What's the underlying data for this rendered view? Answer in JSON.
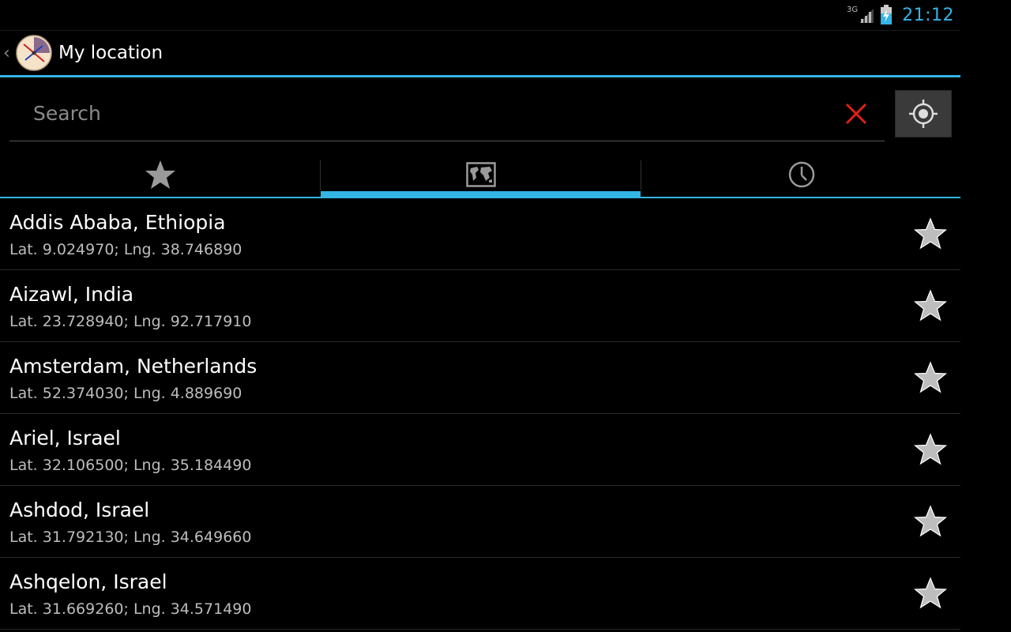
{
  "status": {
    "network": "3G",
    "time": "21:12"
  },
  "action_bar": {
    "title": "My location"
  },
  "search": {
    "placeholder": "Search",
    "value": ""
  },
  "tabs": [
    {
      "icon": "star-icon",
      "selected": false
    },
    {
      "icon": "world-map-icon",
      "selected": true
    },
    {
      "icon": "clock-icon",
      "selected": false
    }
  ],
  "locations": [
    {
      "name": "Addis Ababa, Ethiopia",
      "coords": "Lat. 9.024970; Lng. 38.746890"
    },
    {
      "name": "Aizawl, India",
      "coords": "Lat. 23.728940; Lng. 92.717910"
    },
    {
      "name": "Amsterdam, Netherlands",
      "coords": "Lat. 52.374030; Lng. 4.889690"
    },
    {
      "name": "Ariel, Israel",
      "coords": "Lat. 32.106500; Lng. 35.184490"
    },
    {
      "name": "Ashdod, Israel",
      "coords": "Lat. 31.792130; Lng. 34.649660"
    },
    {
      "name": "Ashqelon, Israel",
      "coords": "Lat. 31.669260; Lng. 34.571490"
    }
  ],
  "colors": {
    "accent": "#33b5e5",
    "background": "#000000",
    "clear": "#e0201a"
  }
}
